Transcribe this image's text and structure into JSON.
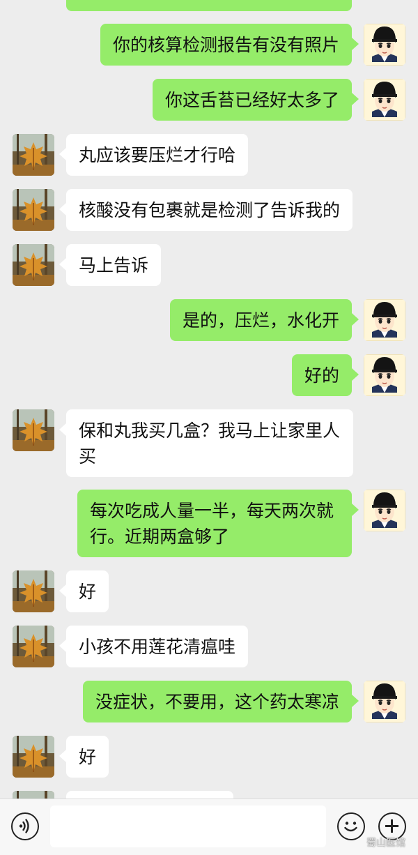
{
  "chat": {
    "messages": [
      {
        "side": "right",
        "text": "你的核算检测报告有没有照片"
      },
      {
        "side": "right",
        "text": "你这舌苔已经好太多了"
      },
      {
        "side": "left",
        "text": "丸应该要压烂才行哈"
      },
      {
        "side": "left",
        "text": "核酸没有包裹就是检测了告诉我的"
      },
      {
        "side": "left",
        "text": "马上告诉"
      },
      {
        "side": "right",
        "text": "是的，压烂，水化开"
      },
      {
        "side": "right",
        "text": "好的"
      },
      {
        "side": "left",
        "text": "保和丸我买几盒？我马上让家里人买"
      },
      {
        "side": "right",
        "text": "每次吃成人量一半，每天两次就行。近期两盒够了"
      },
      {
        "side": "left",
        "text": "好"
      },
      {
        "side": "left",
        "text": "小孩不用莲花清瘟哇"
      },
      {
        "side": "right",
        "text": "没症状，不要用，这个药太寒凉"
      },
      {
        "side": "left",
        "text": "好"
      }
    ]
  },
  "input_bar": {
    "icons": [
      "voice-icon",
      "emoji-icon",
      "plus-icon"
    ],
    "message_value": ""
  },
  "watermark": {
    "text": "蜀山医馆"
  },
  "colors": {
    "sent_bubble": "#95ec69",
    "received_bubble": "#ffffff",
    "background": "#ededed"
  }
}
